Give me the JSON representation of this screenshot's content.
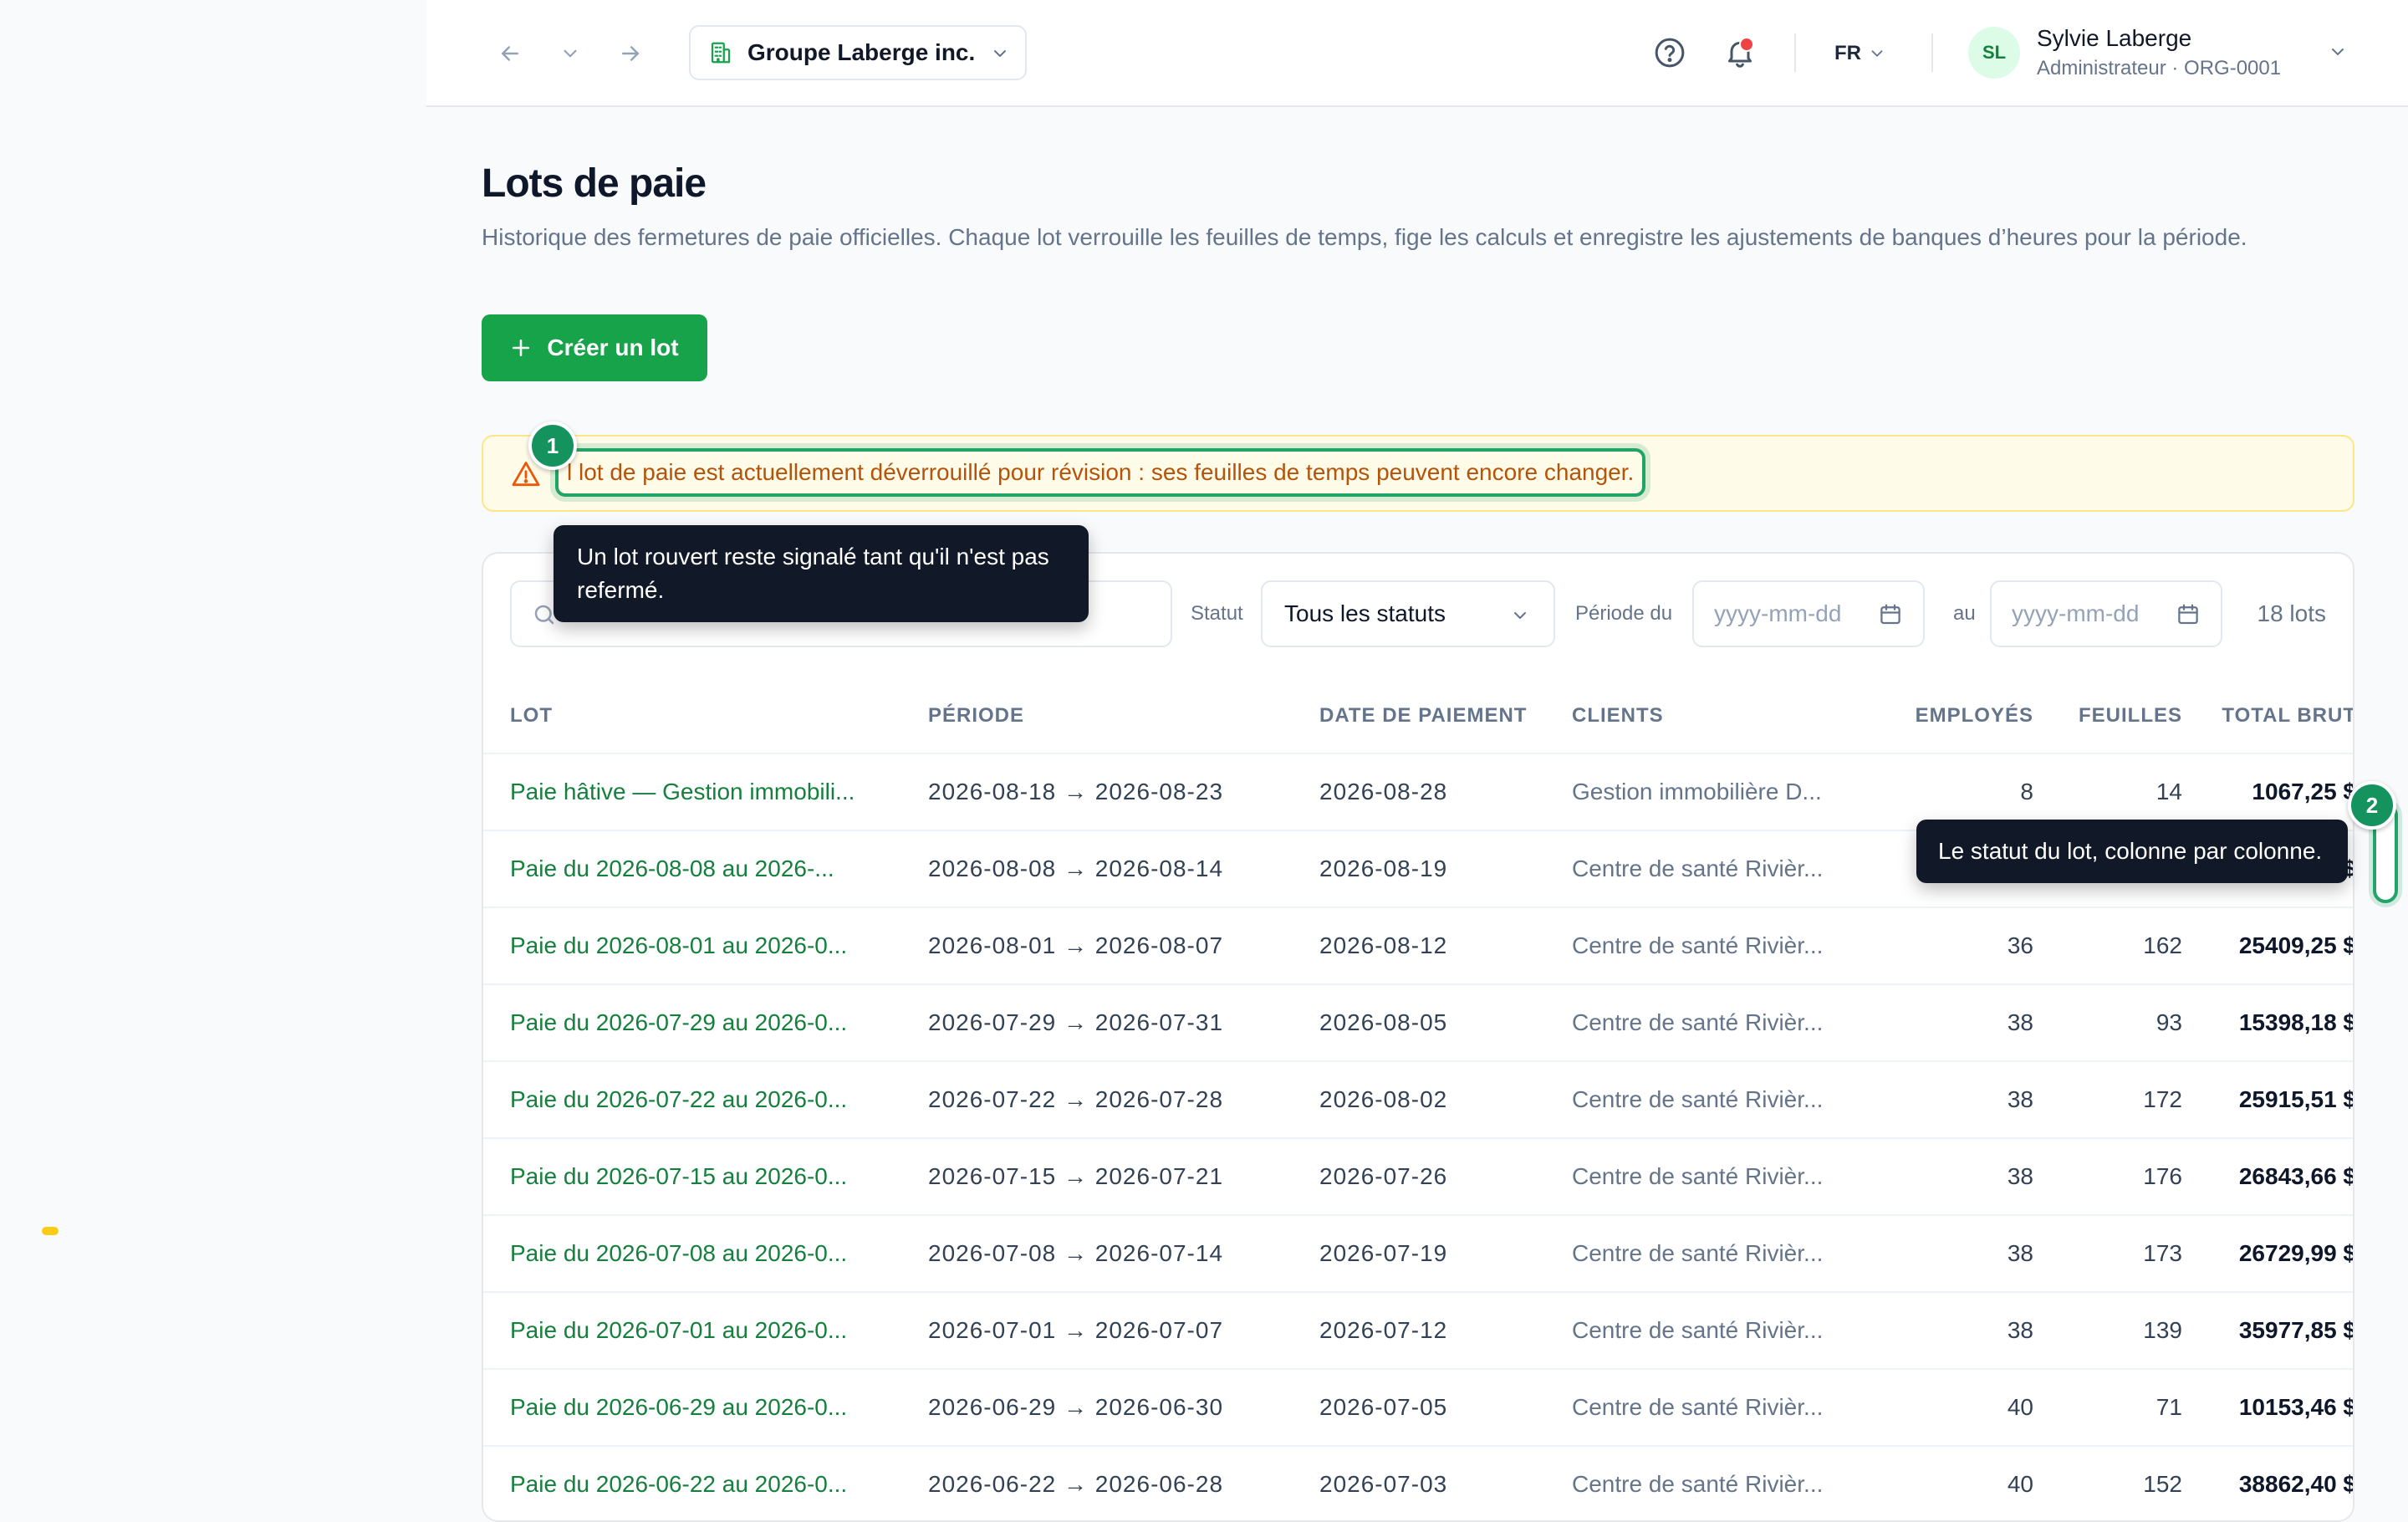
{
  "header": {
    "org_name": "Groupe Laberge inc.",
    "language": "FR",
    "user": {
      "initials": "SL",
      "name": "Sylvie Laberge",
      "role": "Administrateur · ORG-0001"
    },
    "notification_dot_color": "#ef4444"
  },
  "page": {
    "title": "Lots de paie",
    "description": "Historique des fermetures de paie officielles. Chaque lot verrouille les feuilles de temps, fige les calculs et enregistre les ajustements de banques d’heures pour la période.",
    "create_button": "Créer un lot"
  },
  "banner": {
    "text": "l lot de paie est actuellement déverrouillé pour révision : ses feuilles de temps peuvent encore changer."
  },
  "guide": {
    "step1": {
      "number": "1",
      "tooltip": "Un lot rouvert reste signalé tant qu'il n'est pas refermé."
    },
    "step2": {
      "number": "2",
      "tooltip": "Le statut du lot, colonne par colonne."
    }
  },
  "filters": {
    "search_value": "",
    "status_label": "Statut",
    "status_value": "Tous les statuts",
    "period_from_label": "Période du",
    "period_to_label": "au",
    "date_placeholder": "yyyy-mm-dd",
    "count": "18 lots"
  },
  "table": {
    "headers": {
      "lot": "LOT",
      "period": "PÉRIODE",
      "pay_date": "DATE DE PAIEMENT",
      "clients": "CLIENTS",
      "employees": "EMPLOYÉS",
      "sheets": "FEUILLES",
      "gross": "TOTAL BRUT"
    },
    "rows": [
      {
        "lot": "Paie hâtive — Gestion immobili...",
        "period": "2026-08-18 → 2026-08-23",
        "pay_date": "2026-08-28",
        "clients": "Gestion immobilière D...",
        "employees": "8",
        "sheets": "14",
        "gross": "1067,25 $"
      },
      {
        "lot": "Paie du 2026-08-08 au 2026-...",
        "period": "2026-08-08 → 2026-08-14",
        "pay_date": "2026-08-19",
        "clients": "Centre de santé Rivièr...",
        "employees": "",
        "sheets": "",
        "gross": "$"
      },
      {
        "lot": "Paie du 2026-08-01 au 2026-0...",
        "period": "2026-08-01 → 2026-08-07",
        "pay_date": "2026-08-12",
        "clients": "Centre de santé Rivièr...",
        "employees": "36",
        "sheets": "162",
        "gross": "25409,25 $"
      },
      {
        "lot": "Paie du 2026-07-29 au 2026-0...",
        "period": "2026-07-29 → 2026-07-31",
        "pay_date": "2026-08-05",
        "clients": "Centre de santé Rivièr...",
        "employees": "38",
        "sheets": "93",
        "gross": "15398,18 $"
      },
      {
        "lot": "Paie du 2026-07-22 au 2026-0...",
        "period": "2026-07-22 → 2026-07-28",
        "pay_date": "2026-08-02",
        "clients": "Centre de santé Rivièr...",
        "employees": "38",
        "sheets": "172",
        "gross": "25915,51 $"
      },
      {
        "lot": "Paie du 2026-07-15 au 2026-0...",
        "period": "2026-07-15 → 2026-07-21",
        "pay_date": "2026-07-26",
        "clients": "Centre de santé Rivièr...",
        "employees": "38",
        "sheets": "176",
        "gross": "26843,66 $"
      },
      {
        "lot": "Paie du 2026-07-08 au 2026-0...",
        "period": "2026-07-08 → 2026-07-14",
        "pay_date": "2026-07-19",
        "clients": "Centre de santé Rivièr...",
        "employees": "38",
        "sheets": "173",
        "gross": "26729,99 $"
      },
      {
        "lot": "Paie du 2026-07-01 au 2026-0...",
        "period": "2026-07-01 → 2026-07-07",
        "pay_date": "2026-07-12",
        "clients": "Centre de santé Rivièr...",
        "employees": "38",
        "sheets": "139",
        "gross": "35977,85 $"
      },
      {
        "lot": "Paie du 2026-06-29 au 2026-0...",
        "period": "2026-06-29 → 2026-06-30",
        "pay_date": "2026-07-05",
        "clients": "Centre de santé Rivièr...",
        "employees": "40",
        "sheets": "71",
        "gross": "10153,46 $"
      },
      {
        "lot": "Paie du 2026-06-22 au 2026-0...",
        "period": "2026-06-22 → 2026-06-28",
        "pay_date": "2026-07-03",
        "clients": "Centre de santé Rivièr...",
        "employees": "40",
        "sheets": "152",
        "gross": "38862,40 $"
      }
    ]
  },
  "colors": {
    "accent": "#16a34a",
    "link": "#15803d",
    "guide_marker": "#15935f",
    "banner_bg": "#fefce8",
    "banner_text": "#b45309"
  },
  "icons": {
    "back": "arrow-left-icon",
    "history": "chevron-down-icon",
    "forward": "arrow-right-icon",
    "org": "building-icon",
    "help": "help-circle-icon",
    "notifications": "bell-icon",
    "warning": "warning-triangle-icon",
    "search": "search-icon",
    "calendar": "calendar-icon"
  }
}
